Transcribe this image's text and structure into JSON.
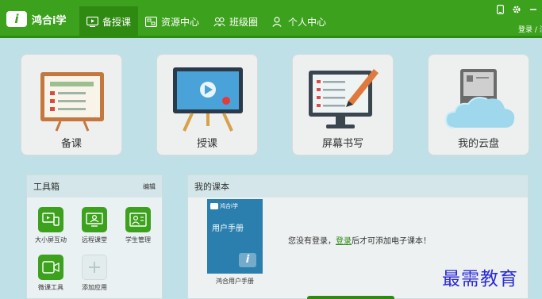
{
  "app": {
    "logo_mark": "i",
    "name": "鸿合i学"
  },
  "nav": [
    {
      "label": "备授课",
      "icon": "play-board-icon",
      "active": true
    },
    {
      "label": "资源中心",
      "icon": "resources-icon",
      "active": false
    },
    {
      "label": "班级圈",
      "icon": "class-circle-icon",
      "active": false
    },
    {
      "label": "个人中心",
      "icon": "person-icon",
      "active": false
    }
  ],
  "window_controls": {
    "phone_icon": "phone-icon",
    "settings_icon": "gear-icon",
    "minimize_icon": "minimize-icon"
  },
  "login_link": "登录 / 注",
  "cards": [
    {
      "title": "备课",
      "icon": "lesson-plan-board-icon"
    },
    {
      "title": "授课",
      "icon": "teaching-easel-icon"
    },
    {
      "title": "屏幕书写",
      "icon": "screen-writing-icon"
    },
    {
      "title": "我的云盘",
      "icon": "cloud-disk-icon"
    }
  ],
  "toolbox": {
    "title": "工具箱",
    "edit": "编辑",
    "tools": [
      {
        "label": "大小屏互动",
        "icon": "screen-interaction-icon"
      },
      {
        "label": "远程课堂",
        "icon": "remote-classroom-icon"
      },
      {
        "label": "学生管理",
        "icon": "student-management-icon"
      },
      {
        "label": "微课工具",
        "icon": "micro-lesson-icon"
      },
      {
        "label": "添加应用",
        "icon": "add-icon"
      }
    ]
  },
  "my_books": {
    "title": "我的课本",
    "book": {
      "brand": "鸿合i学",
      "title": "用户手册",
      "caption": "鸿合用户手册"
    },
    "notice_before": "您没有登录，",
    "notice_link": "登录",
    "notice_after": "后才可添加电子课本！"
  },
  "watermark": "最需教育",
  "colors": {
    "brand_green": "#3ca11c",
    "dark_green": "#2f8a12",
    "background": "#bfe0e6",
    "book_blue": "#2a7fae"
  }
}
